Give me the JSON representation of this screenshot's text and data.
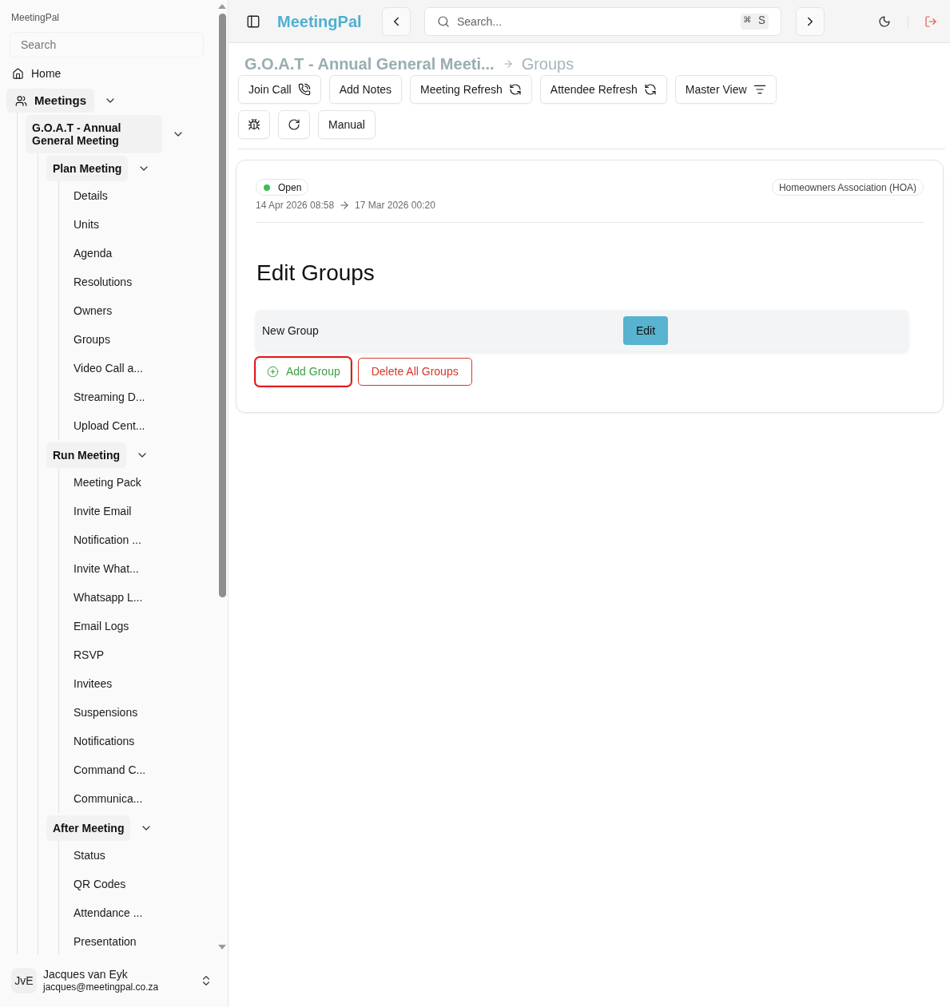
{
  "sidebar": {
    "app_name": "MeetingPal",
    "search": {
      "placeholder": "Search"
    },
    "nav": [
      {
        "label": "Home",
        "kind": "link"
      },
      {
        "label": "Meetings",
        "kind": "group",
        "expanded": true,
        "children": [
          {
            "label": "G.O.A.T - Annual General Meeting",
            "kind": "group",
            "expanded": true,
            "children": [
              {
                "label": "Plan Meeting",
                "kind": "group",
                "expanded": true,
                "children": [
                  {
                    "label": "Details",
                    "kind": "page"
                  },
                  {
                    "label": "Units",
                    "kind": "page"
                  },
                  {
                    "label": "Agenda",
                    "kind": "page"
                  },
                  {
                    "label": "Resolutions",
                    "kind": "page"
                  },
                  {
                    "label": "Owners",
                    "kind": "page"
                  },
                  {
                    "label": "Groups",
                    "kind": "page"
                  },
                  {
                    "label": "Video Call a...",
                    "kind": "page"
                  },
                  {
                    "label": "Streaming D...",
                    "kind": "page"
                  },
                  {
                    "label": "Upload Cent...",
                    "kind": "page"
                  }
                ]
              },
              {
                "label": "Run Meeting",
                "kind": "group",
                "expanded": true,
                "children": [
                  {
                    "label": "Meeting Pack",
                    "kind": "page"
                  },
                  {
                    "label": "Invite Email",
                    "kind": "page"
                  },
                  {
                    "label": "Notification ...",
                    "kind": "page"
                  },
                  {
                    "label": "Invite What...",
                    "kind": "page"
                  },
                  {
                    "label": "Whatsapp L...",
                    "kind": "page"
                  },
                  {
                    "label": "Email Logs",
                    "kind": "page"
                  },
                  {
                    "label": "RSVP",
                    "kind": "page"
                  },
                  {
                    "label": "Invitees",
                    "kind": "page"
                  },
                  {
                    "label": "Suspensions",
                    "kind": "page"
                  },
                  {
                    "label": "Notifications",
                    "kind": "page"
                  },
                  {
                    "label": "Command C...",
                    "kind": "page"
                  },
                  {
                    "label": "Communica...",
                    "kind": "page"
                  }
                ]
              },
              {
                "label": "After Meeting",
                "kind": "group",
                "expanded": true,
                "children": [
                  {
                    "label": "Status",
                    "kind": "page"
                  },
                  {
                    "label": "QR Codes",
                    "kind": "page"
                  },
                  {
                    "label": "Attendance ...",
                    "kind": "page"
                  },
                  {
                    "label": "Presentation",
                    "kind": "page"
                  }
                ]
              }
            ]
          }
        ]
      }
    ],
    "user": {
      "initials": "JvE",
      "name": "Jacques van Eyk",
      "email": "jacques@meetingpal.co.za"
    }
  },
  "header": {
    "brand": "MeetingPal",
    "search": {
      "placeholder": "Search...",
      "shortcut": "⌘ S"
    }
  },
  "breadcrumb": [
    "G.O.A.T - Annual General Meeti...",
    "Groups"
  ],
  "toolbar": [
    [
      {
        "kind": "text",
        "label": "Join Call"
      },
      {
        "kind": "text",
        "label": "Add Notes"
      },
      {
        "kind": "text",
        "label": "Meeting Refresh"
      },
      {
        "kind": "text",
        "label": "Attendee Refresh"
      },
      {
        "kind": "text",
        "label": "Master View"
      }
    ],
    [
      {
        "kind": "icon"
      },
      {
        "kind": "icon"
      },
      {
        "kind": "text",
        "label": "Manual"
      }
    ]
  ],
  "meeting": {
    "status": "Open",
    "category": "Homeowners Association (HOA)",
    "start": "14 Apr 2026 08:58",
    "end": "17 Mar 2026 00:20"
  },
  "editor": {
    "heading": "Edit Groups",
    "groups": [
      {
        "name": "New Group",
        "action": "Edit"
      }
    ],
    "actions": [
      {
        "kind": "add",
        "label": "Add Group",
        "highlighted": true
      },
      {
        "kind": "delete",
        "label": "Delete All Groups",
        "highlighted": false
      }
    ]
  }
}
